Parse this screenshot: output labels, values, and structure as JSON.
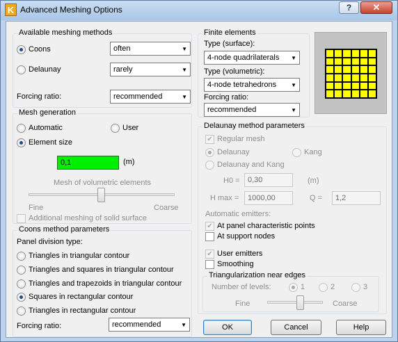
{
  "window": {
    "title": "Advanced Meshing Options",
    "help_glyph": "?",
    "close_glyph": "✕",
    "app_icon_letter": "K"
  },
  "meshing_methods": {
    "title": "Available meshing methods",
    "coons_label": "Coons",
    "coons_value": "often",
    "coons_selected": true,
    "delaunay_label": "Delaunay",
    "delaunay_value": "rarely",
    "forcing_label": "Forcing ratio:",
    "forcing_value": "recommended"
  },
  "mesh_generation": {
    "title": "Mesh generation",
    "automatic_label": "Automatic",
    "user_label": "User",
    "element_size_label": "Element size",
    "element_size_value": "0,1",
    "unit": "(m)",
    "volumetric_label": "Mesh of volumetric elements",
    "fine_label": "Fine",
    "coarse_label": "Coarse",
    "additional_label": "Additional meshing of solid surface"
  },
  "coons_params": {
    "title": "Coons method parameters",
    "panel_division_label": "Panel division type:",
    "options": [
      "Triangles in triangular contour",
      "Triangles and squares in triangular contour",
      "Triangles and trapezoids in triangular contour",
      "Squares in rectangular contour",
      "Triangles in rectangular contour"
    ],
    "selected_index": 3,
    "forcing_label": "Forcing ratio:",
    "forcing_value": "recommended"
  },
  "finite_elements": {
    "title": "Finite elements",
    "surface_label": "Type (surface):",
    "surface_value": "4-node quadrilaterals",
    "volumetric_label": "Type (volumetric):",
    "volumetric_value": "4-node tetrahedrons",
    "forcing_label": "Forcing ratio:",
    "forcing_value": "recommended",
    "preview_cell_color": "#ffff00"
  },
  "delaunay_params": {
    "title": "Delaunay method parameters",
    "regular_mesh_label": "Regular mesh",
    "delaunay_label": "Delaunay",
    "kang_label": "Kang",
    "delaunay_kang_label": "Delaunay and Kang",
    "h0_label": "H0 =",
    "h0_value": "0,30",
    "h0_unit": "(m)",
    "hmax_label": "H max =",
    "hmax_value": "1000,00",
    "q_label": "Q =",
    "q_value": "1,2",
    "emitters_label": "Automatic emitters:",
    "panel_points_label": "At panel characteristic points",
    "support_nodes_label": "At support nodes",
    "user_emitters_label": "User emitters",
    "smoothing_label": "Smoothing"
  },
  "triangularization": {
    "title": "Triangularization near edges",
    "levels_label": "Number of levels:",
    "level_1": "1",
    "level_2": "2",
    "level_3": "3",
    "fine_label": "Fine",
    "coarse_label": "Coarse"
  },
  "buttons": {
    "ok": "OK",
    "cancel": "Cancel",
    "help": "Help"
  },
  "colors": {
    "element_size_fill": "#00f000",
    "title_gradient": "#c9ddf2",
    "close_button": "#c7402a"
  }
}
